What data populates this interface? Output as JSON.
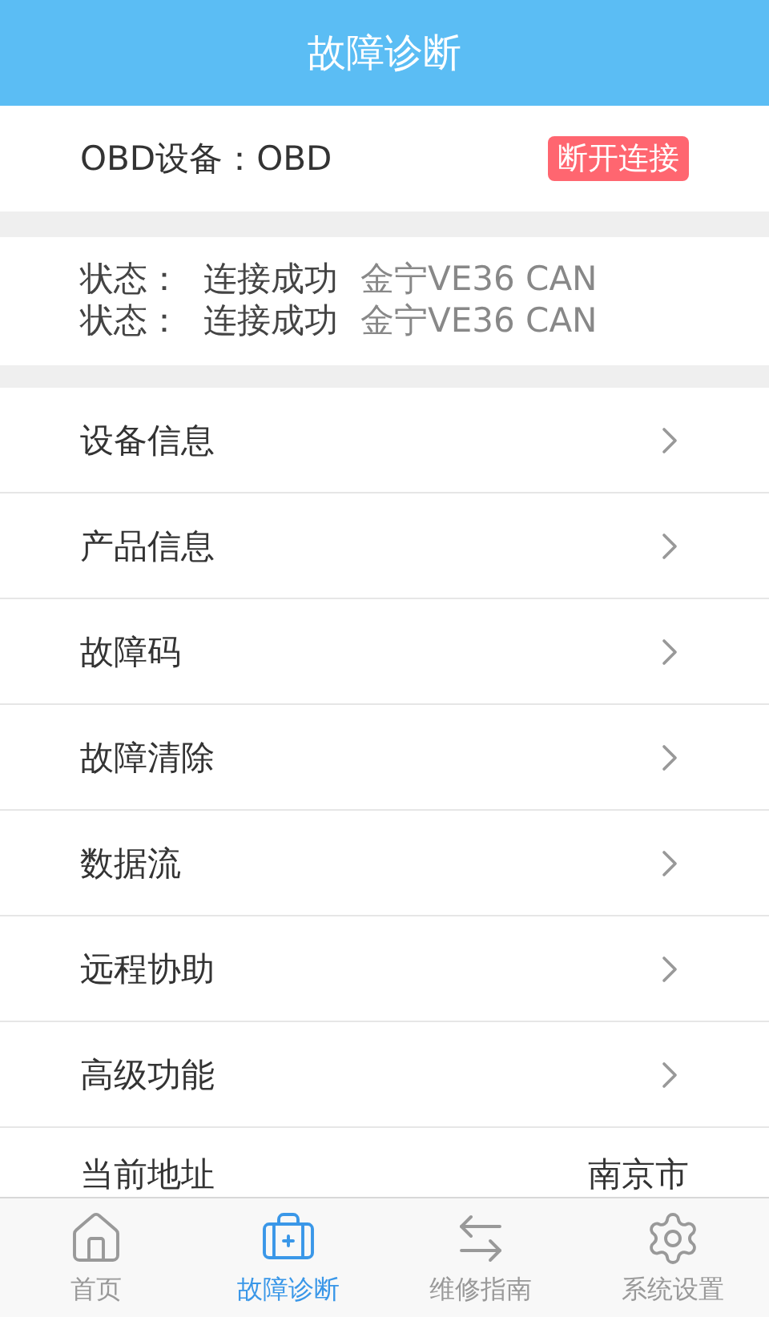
{
  "header": {
    "title": "故障诊断"
  },
  "device": {
    "label": "OBD设备：OBD",
    "button": "断开连接"
  },
  "status_lines": [
    {
      "label": "状态：",
      "value": "连接成功",
      "detail": "金宁VE36 CAN"
    },
    {
      "label": "状态：",
      "value": "连接成功",
      "detail": "金宁VE36 CAN"
    }
  ],
  "menu": [
    {
      "label": "设备信息"
    },
    {
      "label": "产品信息"
    },
    {
      "label": "故障码"
    },
    {
      "label": "故障清除"
    },
    {
      "label": "数据流"
    },
    {
      "label": "远程协助"
    },
    {
      "label": "高级功能"
    }
  ],
  "address": {
    "label": "当前地址",
    "value": "南京市"
  },
  "tabs": [
    {
      "label": "首页",
      "selected": false
    },
    {
      "label": "故障诊断",
      "selected": true
    },
    {
      "label": "维修指南",
      "selected": false
    },
    {
      "label": "系统设置",
      "selected": false
    }
  ]
}
